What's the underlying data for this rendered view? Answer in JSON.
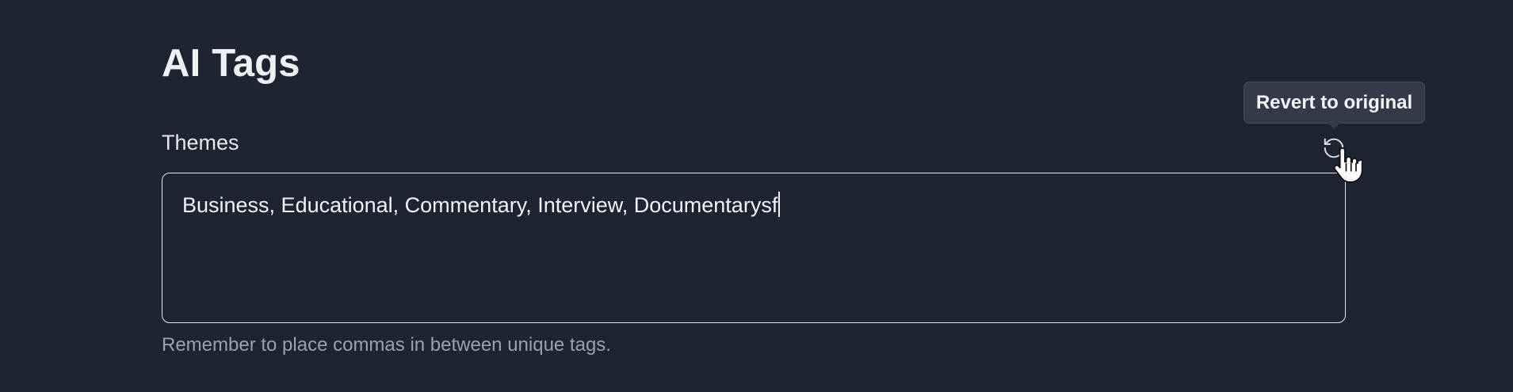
{
  "section": {
    "title": "AI Tags"
  },
  "themes_field": {
    "label": "Themes",
    "value": "Business, Educational, Commentary, Interview, Documentarysf",
    "helper": "Remember to place commas in between unique tags."
  },
  "revert": {
    "tooltip": "Revert to original",
    "icon": "rotate-ccw-icon"
  },
  "cursor": {
    "icon": "hand-pointer-icon"
  },
  "colors": {
    "background": "#1f2432",
    "text": "#eef0f4",
    "muted": "#9aa1ae",
    "border": "#e5e7eb",
    "tooltip_bg": "#343a48"
  }
}
